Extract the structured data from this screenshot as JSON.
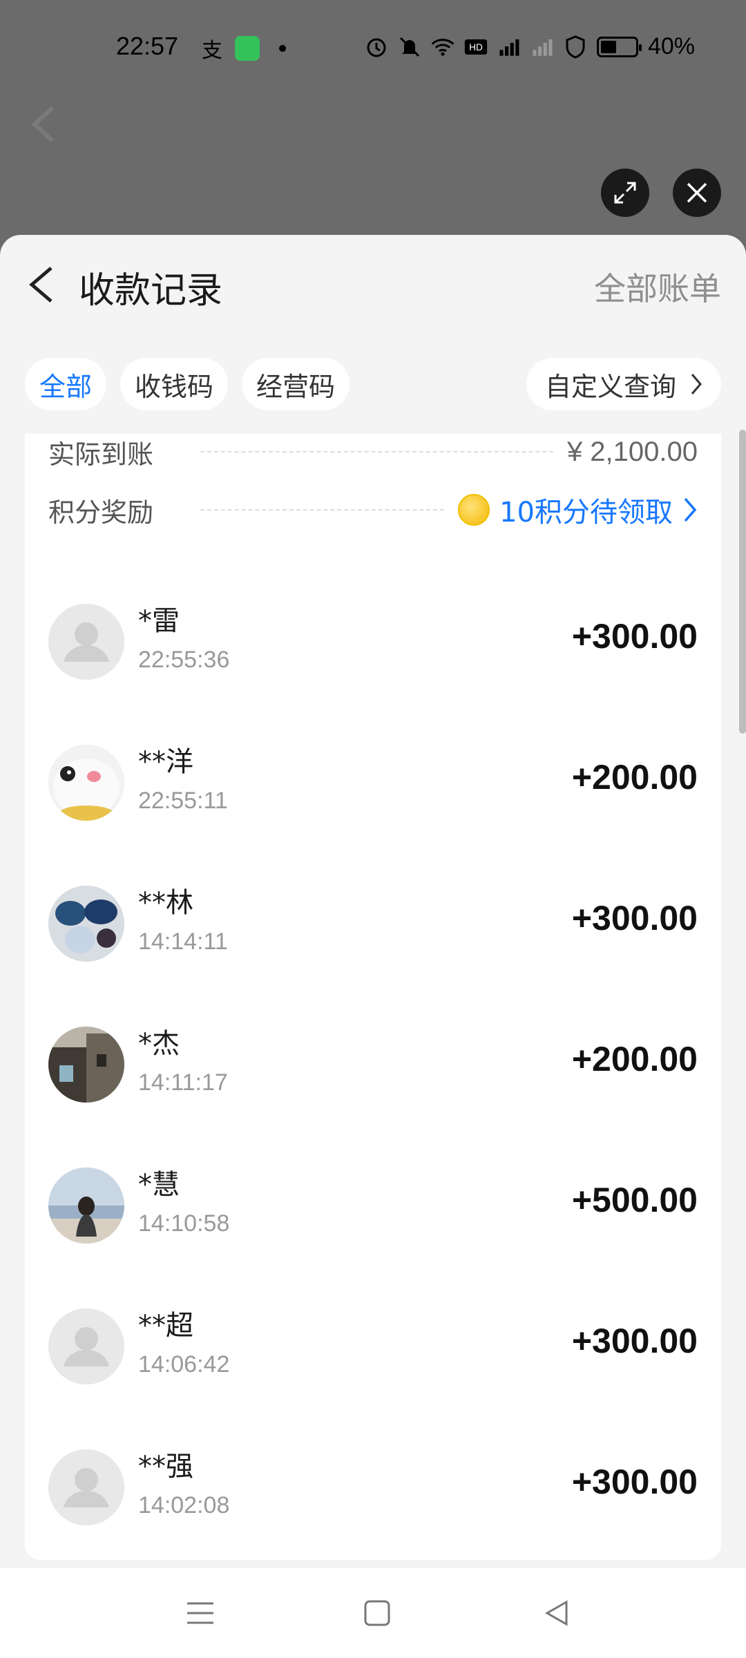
{
  "status_bar": {
    "time": "22:57",
    "zhifubao_glyph": "支",
    "battery_percent": "40%",
    "battery_level": 0.4,
    "icons": [
      "alipay-icon",
      "message-icon",
      "notification-dot-icon",
      "alarm-icon",
      "mute-icon",
      "wifi-icon",
      "hd-icon",
      "signal-5g-icon",
      "signal-off-icon",
      "security-shield-icon",
      "battery-icon"
    ]
  },
  "header": {
    "title": "收款记录",
    "right_link": "全部账单"
  },
  "filters": {
    "all": "全部",
    "collect_code": "收钱码",
    "business_code": "经营码",
    "custom_query": "自定义查询",
    "active": "all"
  },
  "summary": {
    "actual_label": "实际到账",
    "actual_value": "¥ 2,100.00",
    "points_label": "积分奖励",
    "points_value": "10积分待领取"
  },
  "transactions": [
    {
      "name": "*雷",
      "time": "22:55:36",
      "amount": "+300.00",
      "avatar": "default"
    },
    {
      "name": "**洋",
      "time": "22:55:11",
      "amount": "+200.00",
      "avatar": "cat"
    },
    {
      "name": "**林",
      "time": "14:14:11",
      "amount": "+300.00",
      "avatar": "stones"
    },
    {
      "name": "*杰",
      "time": "14:11:17",
      "amount": "+200.00",
      "avatar": "building"
    },
    {
      "name": "*慧",
      "time": "14:10:58",
      "amount": "+500.00",
      "avatar": "beach"
    },
    {
      "name": "**超",
      "time": "14:06:42",
      "amount": "+300.00",
      "avatar": "default"
    },
    {
      "name": "**强",
      "time": "14:02:08",
      "amount": "+300.00",
      "avatar": "default"
    }
  ],
  "colors": {
    "accent": "#1677ff",
    "overlay": "#6b6b6b",
    "sheet_bg": "#f4f4f4"
  }
}
